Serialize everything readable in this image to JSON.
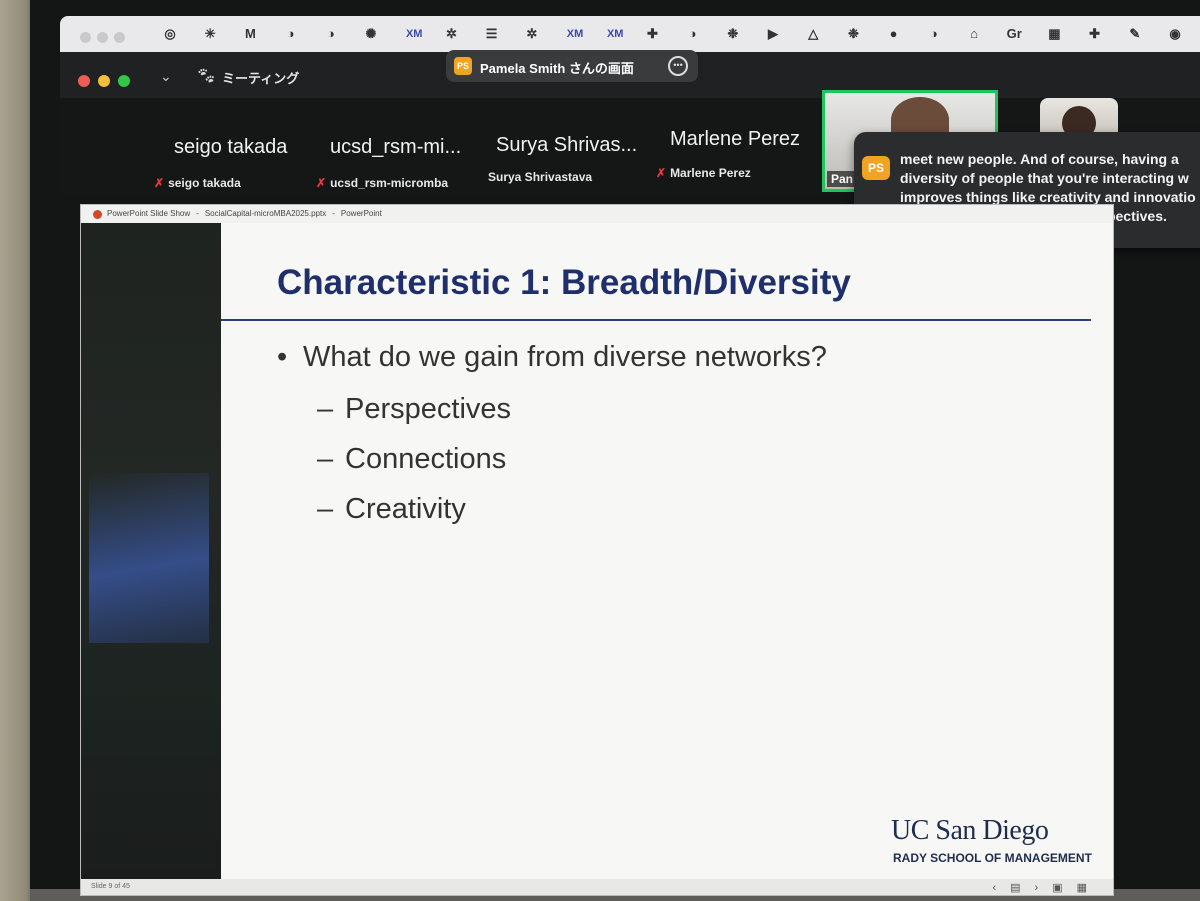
{
  "browser": {
    "bookmarks": [
      {
        "icon": "openai-icon",
        "glyph": "◎"
      },
      {
        "icon": "claude-icon",
        "glyph": "✳"
      },
      {
        "icon": "gmail-icon",
        "glyph": "M"
      },
      {
        "icon": "globe-icon",
        "glyph": "◑"
      },
      {
        "icon": "globe-icon",
        "glyph": "◑"
      },
      {
        "icon": "red-flower-icon",
        "glyph": "✺"
      },
      {
        "icon": "xm-icon",
        "glyph": "XM"
      },
      {
        "icon": "settings-icon",
        "glyph": "✲"
      },
      {
        "icon": "docs-icon",
        "glyph": "☰"
      },
      {
        "icon": "settings-icon",
        "glyph": "✲"
      },
      {
        "icon": "xm-icon",
        "glyph": "XM"
      },
      {
        "icon": "xm-icon",
        "glyph": "XM"
      },
      {
        "icon": "plus-icon",
        "glyph": "✚"
      },
      {
        "icon": "globe-icon",
        "glyph": "◑"
      },
      {
        "icon": "flower-icon",
        "glyph": "❉"
      },
      {
        "icon": "play-store-icon",
        "glyph": "▶"
      },
      {
        "icon": "drive-icon",
        "glyph": "△"
      },
      {
        "icon": "flower-icon",
        "glyph": "❉"
      },
      {
        "icon": "circle-icon",
        "glyph": "●"
      },
      {
        "icon": "globe-icon",
        "glyph": "◑"
      },
      {
        "icon": "building-icon",
        "glyph": "⌂"
      },
      {
        "icon": "translate-icon",
        "glyph": "Gr"
      },
      {
        "icon": "grid-icon",
        "glyph": "▦"
      },
      {
        "icon": "plus-icon",
        "glyph": "✚"
      },
      {
        "icon": "pin-icon",
        "glyph": "✎"
      },
      {
        "icon": "github-icon",
        "glyph": "◉"
      }
    ]
  },
  "zoom": {
    "meeting_label": "ミーティング",
    "share_badge": "PS",
    "share_name": "Pamela Smith さんの画面",
    "participants": [
      {
        "display": "seigo takada",
        "name": "seigo takada",
        "muted": true
      },
      {
        "display": "ucsd_rsm-mi...",
        "name": "ucsd_rsm-micromba",
        "muted": true
      },
      {
        "display": "Surya Shrivas...",
        "name": "Surya Shrivastava",
        "muted": false
      },
      {
        "display": "Marlene Perez",
        "name": "Marlene Perez",
        "muted": true
      }
    ],
    "video_label": "Pan",
    "caption": {
      "badge": "PS",
      "text": "meet new people. And of course, having a diversity of people that you're interacting w improves things like creativity and innovatio because of these different perspectives."
    }
  },
  "ppt": {
    "window_title": [
      "PowerPoint Slide Show",
      "-",
      "SocialCapital-microMBA2025.pptx",
      "-",
      "PowerPoint"
    ],
    "slide": {
      "title": "Characteristic 1: Breadth/Diversity",
      "bullet": "What do we gain from diverse networks?",
      "bullet_marker": "•",
      "dash": "–",
      "subpoints": [
        "Perspectives",
        "Connections",
        "Creativity"
      ],
      "logo": "UC San Diego",
      "logo_sub": "RADY SCHOOL OF MANAGEMENT"
    },
    "status": "Slide 9 of 45",
    "status_icons": [
      "prev-icon",
      "menu-icon",
      "next-icon",
      "slides-icon",
      "grid-icon"
    ]
  }
}
